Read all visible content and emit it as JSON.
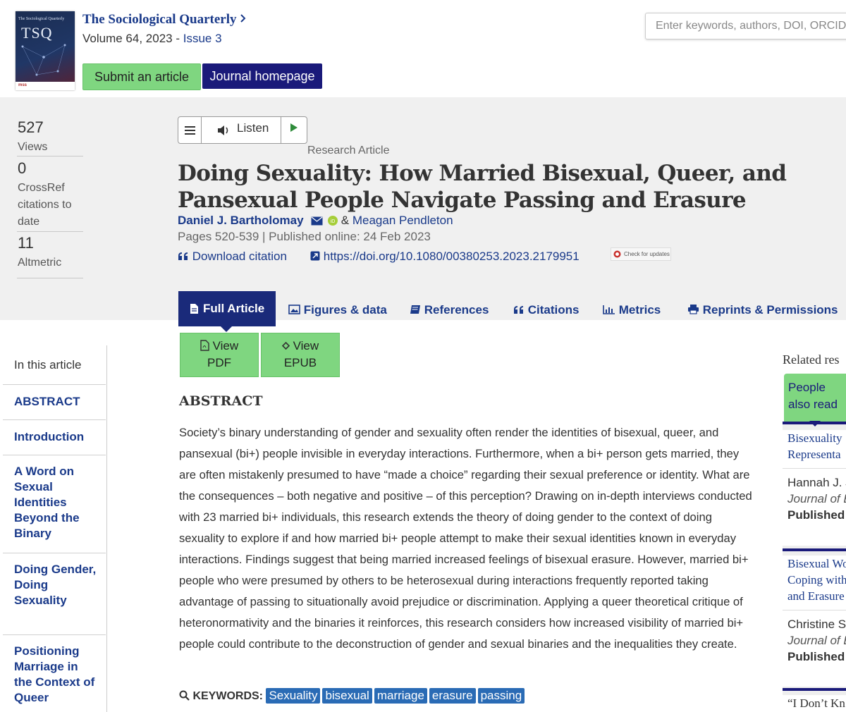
{
  "journal": {
    "cover_top_text": "The Sociological Quarterly",
    "cover_abbrev": "TSQ",
    "cover_logo": "mss",
    "title": "The Sociological Quarterly",
    "volume_text": "Volume 64, 2023 - ",
    "issue_link": "Issue 3",
    "submit_label": "Submit an article",
    "homepage_label": "Journal homepage"
  },
  "search": {
    "placeholder": "Enter keywords, authors, DOI, ORCID"
  },
  "metrics": {
    "views_count": "527",
    "views_label": "Views",
    "crossref_count": "0",
    "crossref_label_1": "CrossRef",
    "crossref_label_2": "citations to",
    "crossref_label_3": "date",
    "altmetric_count": "11",
    "altmetric_label": "Altmetric"
  },
  "listen": {
    "label": "Listen"
  },
  "article": {
    "type": "Research Article",
    "title": "Doing Sexuality: How Married Bisexual, Queer, and Pansexual People Navigate Passing and Erasure",
    "author1": "Daniel J. Bartholomay",
    "amp": "&",
    "author2": "Meagan Pendleton",
    "pages": "Pages 520-539 | Published online: 24 Feb 2023",
    "download_citation": "Download citation",
    "doi": "https://doi.org/10.1080/00380253.2023.2179951",
    "check_updates": "Check for updates"
  },
  "tabs": [
    {
      "label": "Full Article",
      "icon": "document-icon"
    },
    {
      "label": "Figures & data",
      "icon": "image-icon"
    },
    {
      "label": "References",
      "icon": "book-icon"
    },
    {
      "label": "Citations",
      "icon": "quote-icon"
    },
    {
      "label": "Metrics",
      "icon": "bar-chart-icon"
    },
    {
      "label": "Reprints & Permissions",
      "icon": "print-icon"
    }
  ],
  "view_buttons": {
    "pdf_1": "View",
    "pdf_2": "PDF",
    "epub_1": "View",
    "epub_2": "EPUB"
  },
  "nav": {
    "heading": "In this article",
    "items": [
      "ABSTRACT",
      "Introduction",
      "A Word on Sexual Identities Beyond the Binary",
      "Doing Gender, Doing Sexuality",
      "Positioning Marriage in the Context of Queer"
    ]
  },
  "abstract": {
    "heading": "ABSTRACT",
    "text": "Society’s binary understanding of gender and sexuality often render the identities of bisexual, queer, and pansexual (bi+) people invisible in everyday interactions. Furthermore, when a bi+ person gets married, they are often mistakenly presumed to have “made a choice” regarding their sexual preference or identity. What are the consequences – both negative and positive – of this perception? Drawing on in-depth interviews conducted with 23 married bi+ individuals, this research extends the theory of doing gender to the context of doing sexuality to explore if and how married bi+ people attempt to make their sexual identities known in everyday interactions. Findings suggest that being married increased feelings of bisexual erasure. However, married bi+ people who were presumed by others to be heterosexual during interactions frequently reported taking advantage of passing to situationally avoid prejudice or discrimination. Applying a queer theoretical critique of heteronormativity and the binaries it reinforces, this research considers how increased visibility of married bi+ people could contribute to the deconstruction of gender and sexual binaries and the inequalities they create."
  },
  "keywords": {
    "label": "KEYWORDS:",
    "items": [
      "Sexuality",
      "bisexual",
      "marriage",
      "erasure",
      "passing"
    ]
  },
  "sidebar": {
    "related_heading": "Related res",
    "people_1": "People",
    "people_2": "also read",
    "cards": [
      {
        "title_1": "Bisexuality",
        "title_2": "Representa",
        "author": "Hannah J. J",
        "journal": "Journal of B",
        "published": "Published"
      },
      {
        "title_1": "Bisexual Wo",
        "title_2": "Coping with",
        "title_3": "and Erasure",
        "author": "Christine S",
        "journal": "Journal of B",
        "published": "Published"
      },
      {
        "title_1": "“I Don’t Kn"
      }
    ]
  },
  "colors": {
    "link": "#1a3a8a",
    "accent_green": "#7fd680",
    "navy": "#1a1a7a",
    "keyword_chip": "#2a6bb5",
    "band_grey": "#f0f0f0"
  }
}
